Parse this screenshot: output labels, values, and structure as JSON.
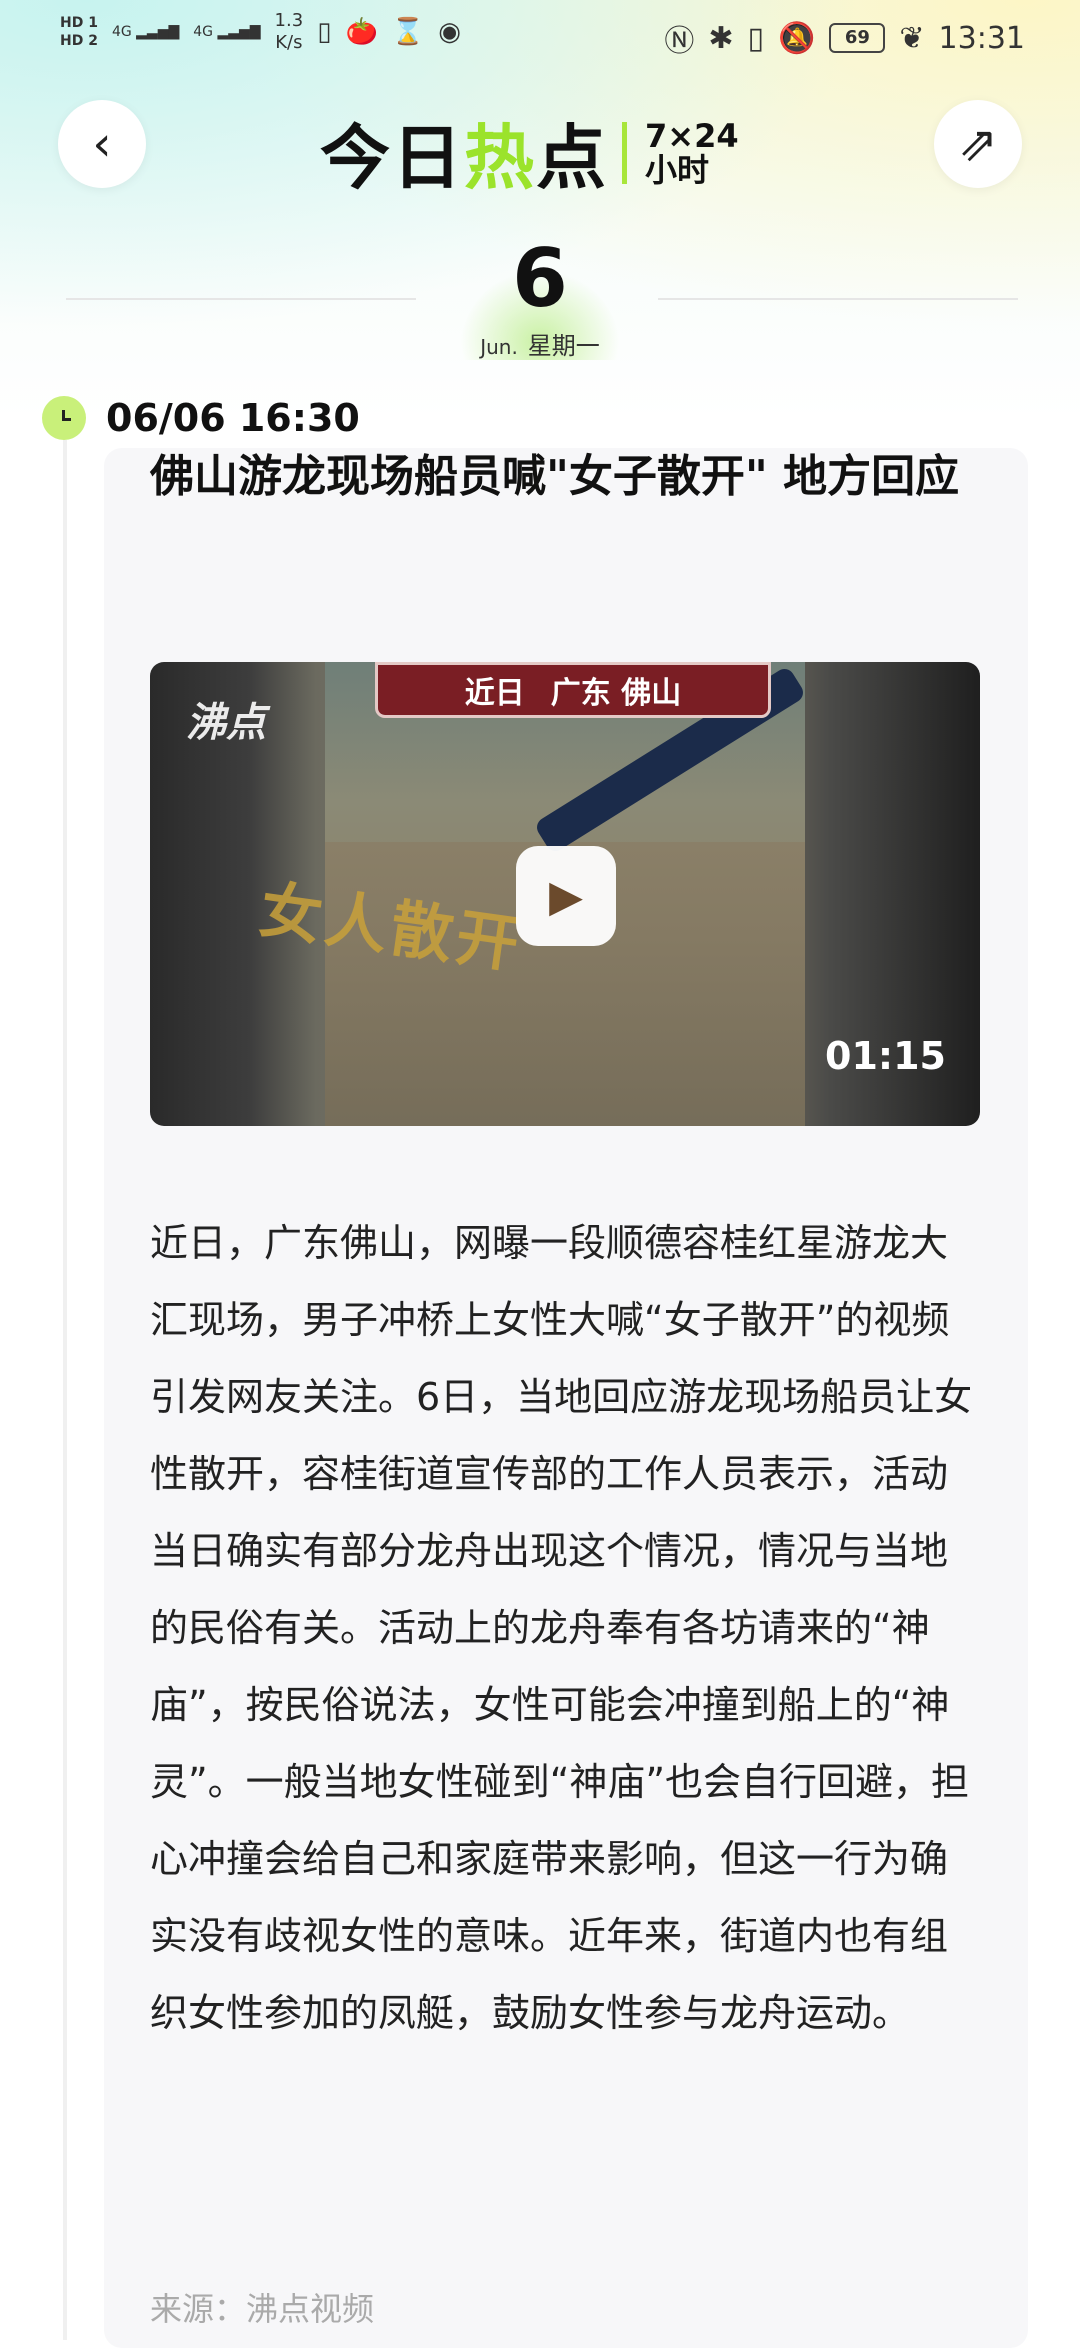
{
  "status_bar": {
    "hd1": "HD 1",
    "hd2": "HD 2",
    "sig1": "4G",
    "sig2": "4G",
    "net_speed": "1.3\nK/s",
    "battery": "69",
    "time": "13:31"
  },
  "header": {
    "brand_main_a": "今日",
    "brand_main_b": "热",
    "brand_main_c": "点",
    "brand_sub_top": "7×24",
    "brand_sub_bottom": "小时"
  },
  "date": {
    "day": "6",
    "month": "Jun.",
    "weekday": "星期一"
  },
  "item": {
    "timestamp": "06/06 16:30",
    "headline": "佛山游龙现场船员喊\"女子散开\" 地方回应",
    "video": {
      "banner_left": "近日",
      "banner_right": "广东 佛山",
      "logo": "沸点",
      "watermark": "女人散开",
      "duration": "01:15"
    },
    "body": "近日，广东佛山，网曝一段顺德容桂红星游龙大汇现场，男子冲桥上女性大喊“女子散开”的视频引发网友关注。6日，当地回应游龙现场船员让女性散开，容桂街道宣传部的工作人员表示，活动当日确实有部分龙舟出现这个情况，情况与当地的民俗有关。活动上的龙舟奉有各坊请来的“神庙”，按民俗说法，女性可能会冲撞到船上的“神灵”。一般当地女性碰到“神庙”也会自行回避，担心冲撞会给自己和家庭带来影响，但这一行为确实没有歧视女性的意味。近年来，街道内也有组织女性参加的凤艇，鼓励女性参与龙舟运动。",
    "source": "来源：沸点视频"
  }
}
